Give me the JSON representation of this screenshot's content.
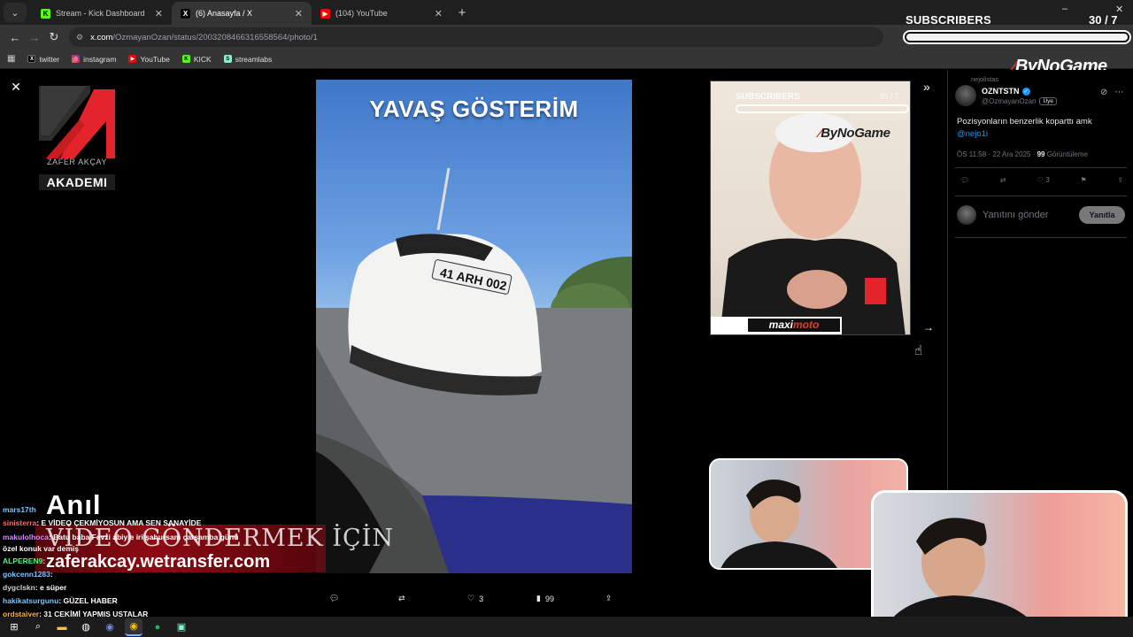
{
  "browser": {
    "tabs": [
      {
        "label": "Stream - Kick Dashboard",
        "favicon": "kick-icon",
        "active": false
      },
      {
        "label": "(6) Anasayfa / X",
        "favicon": "x-icon",
        "active": true
      },
      {
        "label": "(104) YouTube",
        "favicon": "youtube-icon",
        "active": false
      }
    ],
    "url_host": "x.com",
    "url_path": "/OzmayanOzan/status/2003208466316558564/photo/1",
    "bookmarks": [
      {
        "label": "twitter",
        "favicon": "x-icon"
      },
      {
        "label": "instagram",
        "favicon": "instagram-icon"
      },
      {
        "label": "YouTube",
        "favicon": "youtube-icon"
      },
      {
        "label": "KICK",
        "favicon": "kick-icon"
      },
      {
        "label": "streamlabs",
        "favicon": "streamlabs-icon"
      }
    ]
  },
  "overlay": {
    "subscribers_label": "SUBSCRIBERS",
    "subscribers_count": "30 / 7",
    "subscribers_progress": 1.0,
    "brand": "ByNoGame"
  },
  "left_logo": {
    "sub": "ZAFER AKÇAY",
    "akademi": "AKADEMI"
  },
  "video": {
    "title": "YAVAŞ GÖSTERİM"
  },
  "side_video": {
    "subs_label": "SUBSCRIBERS",
    "subs_count": "30 / 7",
    "brand": "ByNoGame",
    "maxi_a": "maxi",
    "maxi_b": "moto"
  },
  "promo": {
    "name": "Anıl",
    "line1": "VİDEO GÖNDERMEK İÇİN",
    "line2": "zaferakcay.wetransfer.com"
  },
  "chat": [
    {
      "user": "mars17th",
      "text": "",
      "color": "blue"
    },
    {
      "user": "sinisterra",
      "text": ": E VİDEO ÇEKMİYOSUN AMA SEN SANAYİDE",
      "color": "red"
    },
    {
      "user": "makulolhoca",
      "text": ": Batu baba Fevzi abiyle iri şahursam çarşamba günü özel konuk var demiş",
      "color": "white"
    },
    {
      "user": "ALPEREN9",
      "text": ":",
      "color": "green"
    },
    {
      "user": "gokcenn1283",
      "text": ":",
      "color": "blue"
    },
    {
      "user": "dygclskn",
      "text": ": e süper",
      "color": "white"
    },
    {
      "user": "hakikatsurgunu",
      "text": ": GÜZEL HABER",
      "color": "blue"
    },
    {
      "user": "ordstajyer",
      "text": ": 31 ÇEKİMİ YAPMIŞ USTALAR",
      "color": "orange"
    }
  ],
  "tweet_actions": {
    "likes": "3",
    "views": "99"
  },
  "panel": {
    "retweeted_by": "nejolistas",
    "name": "OZNTSTN",
    "handle": "@OzmayanOzan",
    "badge": "Üye",
    "text": "Pozisyonların benzerlik koparttı amk",
    "mention": "@nejo1i",
    "meta_time": "ÖS 11:58 · 22 Ara 2025 · ",
    "meta_views": "99",
    "meta_views_label": " Görüntüleme",
    "likes": "3",
    "reply_placeholder": "Yanıtını gönder",
    "reply_button": "Yanıtla"
  },
  "colors": {
    "kick": "#53fc18",
    "youtube": "#ff0000",
    "x_blue": "#1d9bf0",
    "brand_red": "#e0312b"
  }
}
